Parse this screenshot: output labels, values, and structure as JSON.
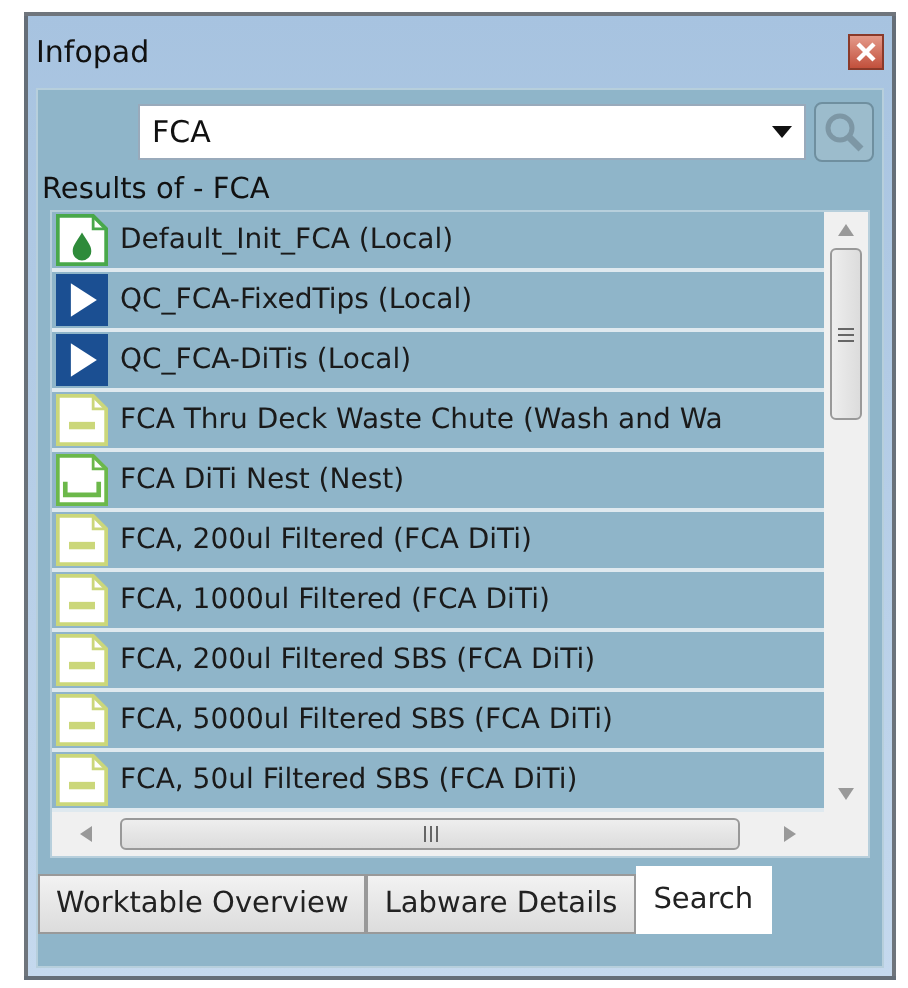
{
  "window": {
    "title": "Infopad"
  },
  "search": {
    "value": "FCA"
  },
  "results_label": "Results of - FCA",
  "results": [
    {
      "kind": "method",
      "label": "Default_Init_FCA (Local)"
    },
    {
      "kind": "script",
      "label": "QC_FCA-FixedTips (Local)"
    },
    {
      "kind": "script",
      "label": "QC_FCA-DiTis (Local)"
    },
    {
      "kind": "labware",
      "label": "FCA Thru Deck Waste Chute (Wash and Wa"
    },
    {
      "kind": "nest",
      "label": "FCA DiTi Nest (Nest)"
    },
    {
      "kind": "labware",
      "label": "FCA, 200ul Filtered (FCA DiTi)"
    },
    {
      "kind": "labware",
      "label": "FCA, 1000ul Filtered (FCA DiTi)"
    },
    {
      "kind": "labware",
      "label": "FCA, 200ul Filtered SBS (FCA DiTi)"
    },
    {
      "kind": "labware",
      "label": "FCA, 5000ul Filtered SBS (FCA DiTi)"
    },
    {
      "kind": "labware",
      "label": "FCA, 50ul Filtered SBS (FCA DiTi)"
    }
  ],
  "tabs": [
    {
      "label": "Worktable Overview",
      "selected": false
    },
    {
      "label": "Labware Details",
      "selected": false
    },
    {
      "label": "Search",
      "selected": true
    }
  ]
}
